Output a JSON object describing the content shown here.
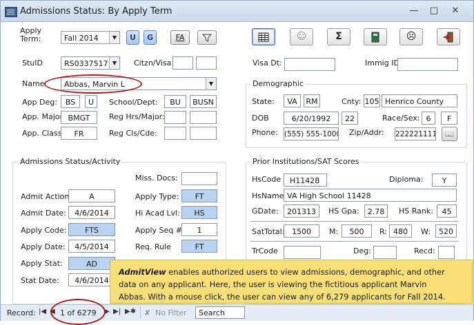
{
  "window": {
    "title": "Admissions Status:  By Apply Term"
  },
  "colors": {
    "titlebar": "#c9d9ec",
    "field_highlight": "#b9d4f3",
    "annotation_bg": "#fae076",
    "highlight_ring": "#b01818"
  },
  "toolbar": {
    "apply_term_label_line1": "Apply",
    "apply_term_label_line2": "Term:",
    "apply_term_value": "Fall 2014",
    "btn_u": "U",
    "btn_g": "G",
    "btn_fa": "FA",
    "icons": [
      "filter-icon",
      "grid-icon",
      "smiley-icon",
      "sigma-icon",
      "book-icon",
      "sad-face-icon",
      "exit-icon"
    ]
  },
  "identity": {
    "stuid_label": "StuID",
    "stuid_value": "RS0337517",
    "citzn_label": "Citzn/Visa:",
    "visa_dt_label": "Visa Dt:",
    "immig_label": "Immig ID:",
    "name_label": "Name",
    "name_value": "Abbas, Marvin L"
  },
  "program": {
    "app_deg_label": "App Deg:",
    "app_deg_value": "BS",
    "app_deg_value2": "U",
    "app_major_label": "App. Major:",
    "app_major_value": "BMGT",
    "app_class_label": "App. Class:",
    "app_class_value": "FR",
    "school_dept_label": "School/Dept:",
    "school_value": "BU",
    "dept_value": "BUSN",
    "reg_hrs_label": "Reg Hrs/Major:",
    "reg_cls_label": "Reg Cls/Cde:"
  },
  "demographic": {
    "title": "Demographic",
    "state_label": "State:",
    "state_value": "VA",
    "state_value2": "RM",
    "cnty_label": "Cnty:",
    "cnty_code": "105",
    "cnty_name": "Henrico County",
    "dob_label": "DOB",
    "dob_value": "6/20/1992",
    "age_value": "22",
    "race_sex_label": "Race/Sex:",
    "race_value": "6",
    "sex_value": "F",
    "phone_label": "Phone:",
    "phone_value": "(555) 555-1000",
    "zip_label": "Zip/Addr:",
    "zip_value": "222221111"
  },
  "admissions": {
    "title": "Admissions Status/Activity",
    "miss_docs_label": "Miss. Docs:",
    "admit_action_label": "Admit Action:",
    "admit_action_value": "A",
    "apply_type_label": "Apply Type:",
    "apply_type_value": "FT",
    "admit_date_label": "Admit Date:",
    "admit_date_value": "4/6/2014",
    "hi_acad_label": "Hi Acad Lvl:",
    "hi_acad_value": "HS",
    "apply_code_label": "Apply Code:",
    "apply_code_value": "FTS",
    "apply_seq_label": "Apply Seq #",
    "apply_seq_value": "1",
    "apply_date_label": "Apply Date:",
    "apply_date_value": "4/5/2014",
    "req_rule_label": "Req. Rule",
    "req_rule_value": "FT",
    "apply_stat_label": "Apply Stat:",
    "apply_stat_value": "AD",
    "stat_date_label": "Stat Date:",
    "stat_date_value": "4/6/2014"
  },
  "prior": {
    "title": "Prior Institutions/SAT Scores",
    "hscode_label": "HsCode",
    "hscode_value": "H11428",
    "diploma_label": "Diploma:",
    "diploma_value": "Y",
    "hsname_label": "HsName",
    "hsname_value": "VA High School 11428",
    "gdate_label": "GDate:",
    "gdate_value": "201313",
    "hs_gpa_label": "HS Gpa:",
    "hs_gpa_value": "2.78",
    "hs_rank_label": "HS Rank:",
    "hs_rank_value": "45",
    "sattotal_label": "SatTotal:",
    "sattotal_value": "1500",
    "m_label": "M:",
    "m_value": "500",
    "r_label": "R:",
    "r_value": "480",
    "w_label": "W:",
    "w_value": "520",
    "trcode_label": "TrCode",
    "deg_label": "Deg:",
    "recd_label": "Recd:"
  },
  "annotation": {
    "app_name": "AdmitView",
    "text_line1": " enables authorized users to view admissions, demographic, and other",
    "text_line2": "data on any applicant.  Here, the user is viewing the fictitious applicant Marvin",
    "text_line3": "Abbas.  With a mouse click, the user can view any of 6,279 applicants for Fall 2014."
  },
  "navigation": {
    "record_label": "Record:",
    "record_position": "1 of 6279",
    "no_filter_label": "No Filter",
    "search_label": "Search"
  }
}
